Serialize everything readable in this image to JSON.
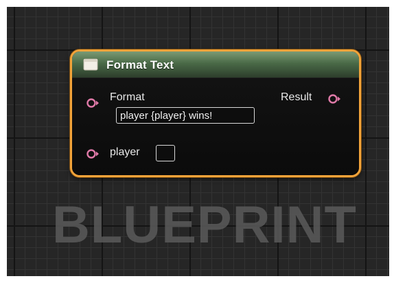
{
  "node": {
    "title": "Format Text",
    "title_icon": "function-icon",
    "inputs": [
      {
        "label": "Format",
        "pin_icon": "text-pin-icon",
        "value": "player {player} wins!"
      },
      {
        "label": "player",
        "pin_icon": "text-pin-icon",
        "value": ""
      }
    ],
    "outputs": [
      {
        "label": "Result",
        "pin_icon": "text-pin-icon"
      }
    ]
  },
  "watermark": "BLUEPRINT",
  "colors": {
    "node_border": "#f2a33a",
    "header": "#4a6a47",
    "pin": "#e07aa8",
    "canvas": "#262626"
  }
}
